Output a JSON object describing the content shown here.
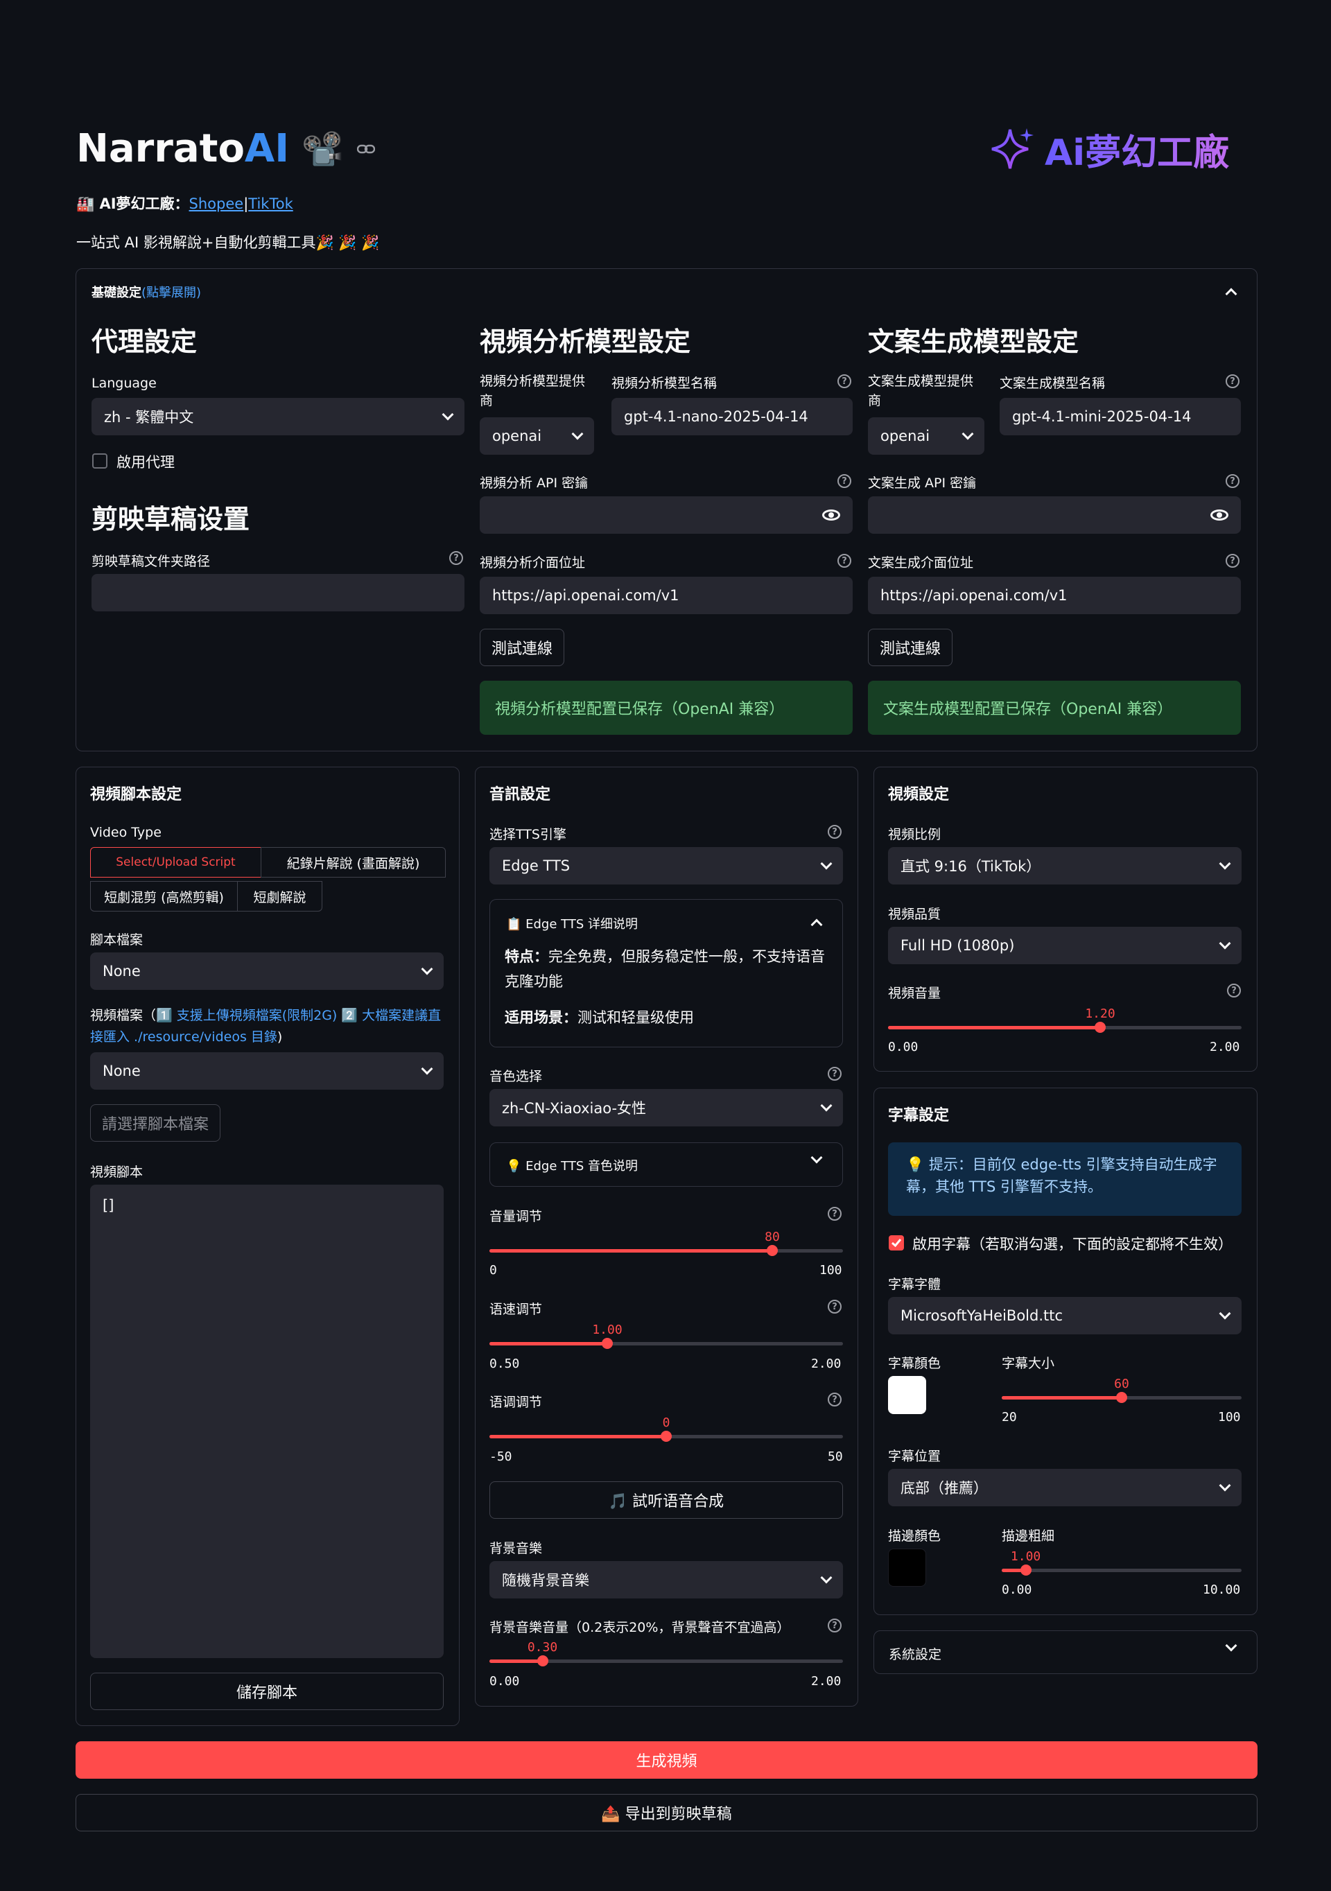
{
  "header": {
    "title_main": "Narrato",
    "title_ai": "AI",
    "title_emoji": "📽️",
    "brand_line_prefix": "🏭 AI夢幻工廠：",
    "shopee": "Shopee",
    "sep": "|",
    "tiktok": "TikTok",
    "tagline": "一站式 AI 影視解說+自動化剪輯工具🎉 🎉 🎉",
    "logo_text": "Ai夢幻工廠"
  },
  "basic": {
    "expander_label": "基礎設定",
    "expander_hint": "(點擊展開)",
    "proxy": {
      "heading": "代理設定",
      "language_label": "Language",
      "language_value": "zh - 繁體中文",
      "enable_proxy": "啟用代理"
    },
    "jianying": {
      "heading": "剪映草稿设置",
      "folder_label": "剪映草稿文件夹路径",
      "folder_value": ""
    },
    "video_model": {
      "heading": "視頻分析模型設定",
      "provider_label": "視頻分析模型提供商",
      "provider_value": "openai",
      "model_label": "視頻分析模型名稱",
      "model_value": "gpt-4.1-nano-2025-04-14",
      "api_key_label": "視頻分析 API 密鑰",
      "api_key_value": "",
      "base_url_label": "視頻分析介面位址",
      "base_url_value": "https://api.openai.com/v1",
      "test_button": "測試連線",
      "success": "視頻分析模型配置已保存（OpenAI 兼容）"
    },
    "text_model": {
      "heading": "文案生成模型設定",
      "provider_label": "文案生成模型提供商",
      "provider_value": "openai",
      "model_label": "文案生成模型名稱",
      "model_value": "gpt-4.1-mini-2025-04-14",
      "api_key_label": "文案生成 API 密鑰",
      "api_key_value": "",
      "base_url_label": "文案生成介面位址",
      "base_url_value": "https://api.openai.com/v1",
      "test_button": "測試連線",
      "success": "文案生成模型配置已保存（OpenAI 兼容）"
    }
  },
  "script": {
    "heading": "視頻腳本設定",
    "video_type_label": "Video Type",
    "tabs": [
      "Select/Upload Script",
      "紀錄片解說 (畫面解說)",
      "短劇混剪 (高燃剪輯)",
      "短劇解說"
    ],
    "script_file_label": "腳本檔案",
    "script_file_value": "None",
    "video_file_label": "視頻檔案（",
    "video_file_hint1": "1️⃣ 支援上傳視頻檔案(限制2G)",
    "video_file_hint2": "2️⃣ 大檔案建議直接匯入 ./resource/videos 目錄",
    "video_file_close": ")",
    "video_file_value": "None",
    "choose_script_button": "請選擇腳本檔案",
    "script_label": "視頻腳本",
    "script_value": "[]",
    "save_button": "儲存腳本"
  },
  "audio": {
    "heading": "音訊設定",
    "tts_engine_label": "选择TTS引擎",
    "tts_engine_value": "Edge TTS",
    "tts_detail_title": "📋 Edge TTS 详细说明",
    "feature_key": "特点：",
    "feature_val": "完全免费，但服务稳定性一般，不支持语音克隆功能",
    "scene_key": "适用场景：",
    "scene_val": "测试和轻量级使用",
    "voice_label": "音色选择",
    "voice_value": "zh-CN-Xiaoxiao-女性",
    "voice_expander": "💡 Edge TTS 音色说明",
    "volume_label": "音量调节",
    "volume": {
      "value": "80",
      "min": "0",
      "max": "100"
    },
    "rate_label": "语速调节",
    "rate": {
      "value": "1.00",
      "min": "0.50",
      "max": "2.00"
    },
    "pitch_label": "语调调节",
    "pitch": {
      "value": "0",
      "min": "-50",
      "max": "50"
    },
    "preview_button": "🎵 試听语音合成",
    "bgm_label": "背景音樂",
    "bgm_value": "隨機背景音樂",
    "bgm_volume_label": "背景音樂音量（0.2表示20%，背景聲音不宜過高）",
    "bgm_volume": {
      "value": "0.30",
      "min": "0.00",
      "max": "2.00"
    }
  },
  "video": {
    "heading": "視頻設定",
    "ratio_label": "視頻比例",
    "ratio_value": "直式 9:16（TikTok）",
    "quality_label": "視頻品質",
    "quality_value": "Full HD (1080p)",
    "volume_label": "視頻音量",
    "volume": {
      "value": "1.20",
      "min": "0.00",
      "max": "2.00"
    }
  },
  "subtitle": {
    "heading": "字幕設定",
    "info": "💡 提示：目前仅 edge-tts 引擎支持自动生成字幕，其他 TTS 引擎暂不支持。",
    "enable_label": "啟用字幕（若取消勾選，下面的設定都將不生效）",
    "font_label": "字幕字體",
    "font_value": "MicrosoftYaHeiBold.ttc",
    "color_label": "字幕顏色",
    "color_value": "#ffffff",
    "size_label": "字幕大小",
    "size": {
      "value": "60",
      "min": "20",
      "max": "100"
    },
    "position_label": "字幕位置",
    "position_value": "底部（推薦）",
    "stroke_color_label": "描邊顏色",
    "stroke_color_value": "#000000",
    "stroke_width_label": "描邊粗細",
    "stroke_width": {
      "value": "1.00",
      "min": "0.00",
      "max": "10.00"
    }
  },
  "system": {
    "label": "系統設定"
  },
  "actions": {
    "generate": "生成視頻",
    "export": "📤 导出到剪映草稿"
  },
  "colors": {
    "accent": "#ff4b4b",
    "link": "#4da3ff",
    "success_bg": "#173f24"
  }
}
